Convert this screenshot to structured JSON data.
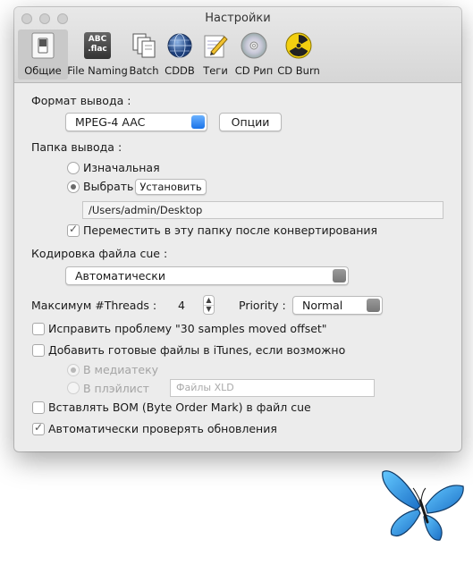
{
  "window": {
    "title": "Настройки"
  },
  "toolbar": {
    "items": [
      {
        "label": "Общие",
        "icon": "general-switch-icon",
        "selected": true
      },
      {
        "label": "File Naming",
        "icon": "abc-flac-icon"
      },
      {
        "label": "Batch",
        "icon": "documents-icon"
      },
      {
        "label": "CDDB",
        "icon": "globe-icon"
      },
      {
        "label": "Теги",
        "icon": "pencil-paper-icon"
      },
      {
        "label": "CD Рип",
        "icon": "cd-disc-icon"
      },
      {
        "label": "CD Burn",
        "icon": "radiation-icon"
      }
    ],
    "abc_icon_line1": "ABC",
    "abc_icon_line2": ".flac"
  },
  "output_format": {
    "label": "Формат вывода :",
    "value": "MPEG-4 AAC",
    "options_button": "Опции"
  },
  "output_folder": {
    "label": "Папка вывода :",
    "radio_original": "Изначальная",
    "radio_choose": "Выбрать",
    "set_button": "Установить",
    "path": "/Users/admin/Desktop",
    "move_checkbox": "Переместить в эту папку после конвертирования"
  },
  "cue_encoding": {
    "label": "Кодировка файла cue :",
    "value": "Автоматически"
  },
  "threads": {
    "label": "Максимум #Threads :",
    "value": "4",
    "priority_label": "Priority :",
    "priority_value": "Normal"
  },
  "checkboxes": {
    "fix_samples": "Исправить проблему \"30 samples moved offset\"",
    "add_itunes": "Добавить готовые файлы в iTunes, если возможно",
    "radio_library": "В медиатеку",
    "radio_playlist": "В плэйлист",
    "playlist_placeholder": "Файлы XLD",
    "insert_bom": "Вставлять BOM (Byte Order Mark) в файл cue",
    "auto_update": "Автоматически проверять обновления"
  },
  "colors": {
    "accent": "#1a73e8",
    "window_bg": "#ececec"
  }
}
